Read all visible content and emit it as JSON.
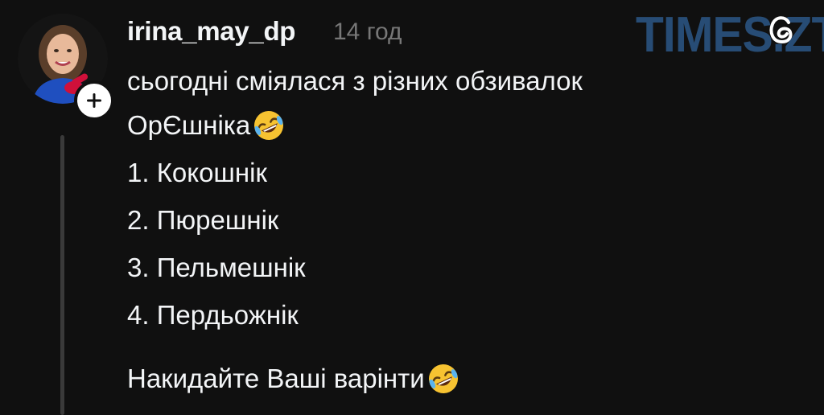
{
  "post": {
    "username": "irina_may_dp",
    "timestamp": "14 год",
    "lines": [
      "сьогодні сміялася з різних обзивалок",
      "ОрЄшніка",
      "1. Кокошнік",
      "2. Пюрешнік",
      "3. Пельмешнік",
      "4. Пердьожнік",
      "Накидайте Ваші варінти"
    ],
    "emoji": "rolling-on-floor-laughing"
  },
  "watermark": {
    "text": "TIMES.ZT"
  },
  "colors": {
    "background": "#101010",
    "text": "#f3f5f7",
    "muted": "#777777",
    "watermark": "#2a5380"
  }
}
